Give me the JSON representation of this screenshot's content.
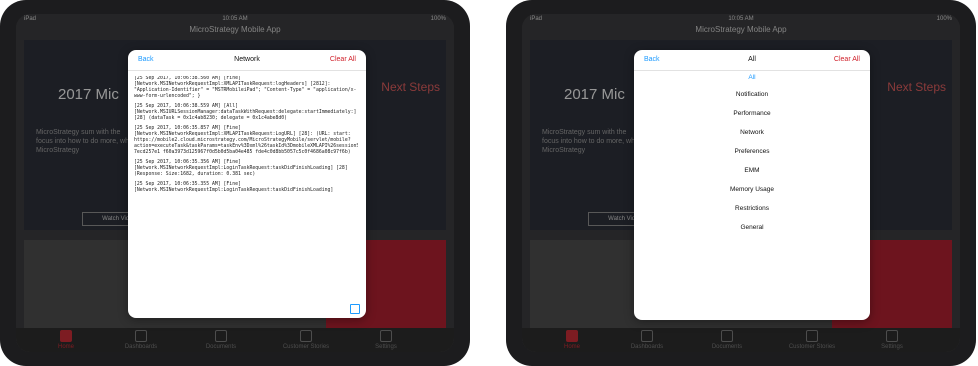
{
  "left": {
    "status": {
      "device": "iPad",
      "time": "10:05 AM",
      "battery": "100%"
    },
    "app_title": "MicroStrategy Mobile App",
    "hero": {
      "title": "2017 Mic",
      "next": "Next Steps",
      "desc": "MicroStrategy sum with the focus into how to do more, why MicroStrategy",
      "button": "Watch Video"
    },
    "popover": {
      "back": "Back",
      "title": "Network",
      "clear": "Clear All",
      "logs": [
        "[25 Sep 2017, 10:06:38.560 AM] [Fine] [Network.MSINetworkRequestImpl:XMLAPITaskRequest:logHeaders] [2812]: \"Application-Identifier\" = \"MSTRMobileiPad\"; \"Content-Type\" = \"application/x-www-form-urlencoded\"; }",
        "[25 Sep 2017, 10:06:38.559 AM] [All] [Network.MSIURLSessionManager:dataTaskWithRequest:delegate:startImmediately:] [28] (dataTask = 0x1c4ab8230; delegate = 0x1c4abe8d0)",
        "[25 Sep 2017, 10:06:35.857 AM] [Fine] [Network.MSINetworkRequestImpl:XMLAPITaskRequest:LogURL] [28]: (URL: start: https://mobile2.cloud.microstrategy.com/MicroStrategyMobile/servlet/mobile? action=executeTask&taskParams=taskEnv%3Dxml%26taskId%3DmobileXMLAPI%26sessionState%3D0.0000001b2716f4a73793019dc787257 7ecd257e1 f60a3973d125967f0d5b0d5ba04e485 fde4c0d8bb5057c5c0f4686a08c97f6b)",
        "[25 Sep 2017, 10:06:35.356 AM] [Fine] [Network.MSINetworkRequestImpl:LoginTaskRequest:taskDidFinishLoading] [28] (Response: Size:1682, duration: 0.381 sec)",
        "[25 Sep 2017, 10:06:35.355 AM] [Fine] [Network.MSINetworkRequestImpl:LoginTaskRequest:taskDidFinishLoading]"
      ]
    },
    "tabs": [
      "Home",
      "Dashboards",
      "Documents",
      "Customer Stories",
      "Settings"
    ]
  },
  "right": {
    "status": {
      "device": "iPad",
      "time": "10:05 AM",
      "battery": "100%"
    },
    "app_title": "MicroStrategy Mobile App",
    "hero": {
      "title": "2017 Mic",
      "next": "Next Steps",
      "desc": "MicroStrategy sum with the focus into how to do more, why MicroStrategy",
      "button": "Watch Video"
    },
    "popover": {
      "back": "Back",
      "title": "All",
      "clear": "Clear All",
      "items": [
        "All",
        "Notification",
        "Performance",
        "Network",
        "Preferences",
        "EMM",
        "Memory Usage",
        "Restrictions",
        "General"
      ]
    },
    "tabs": [
      "Home",
      "Dashboards",
      "Documents",
      "Customer Stories",
      "Settings"
    ]
  }
}
